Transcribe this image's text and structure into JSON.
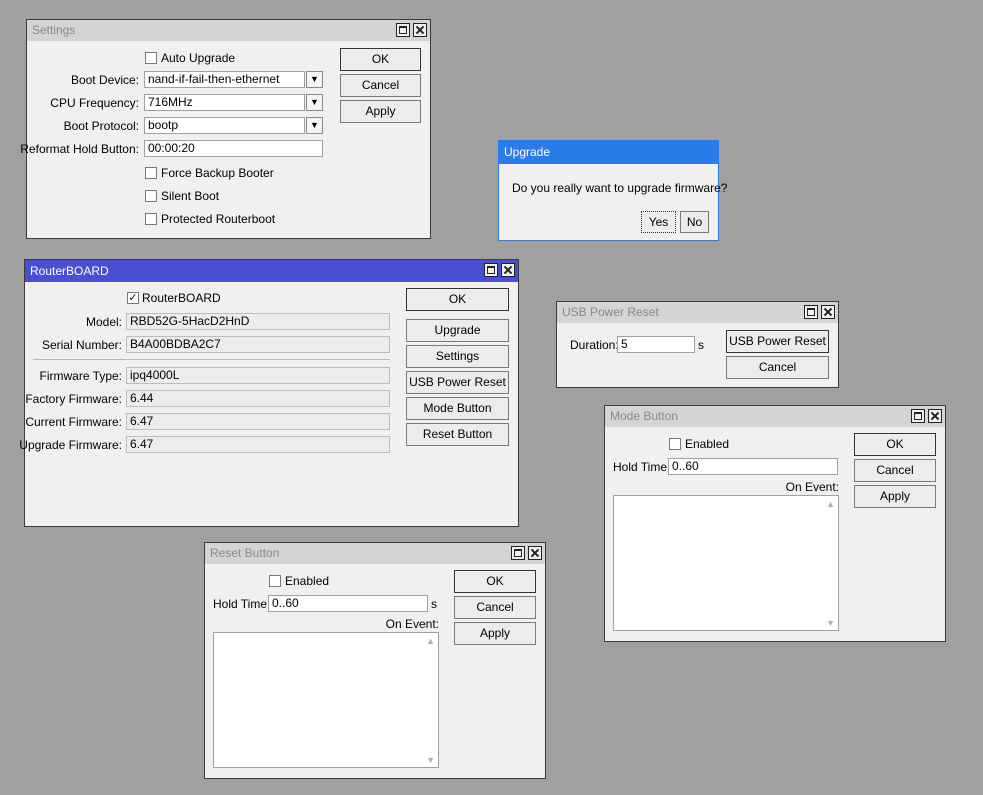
{
  "settings": {
    "title": "Settings",
    "auto_upgrade": {
      "label": "Auto Upgrade",
      "checked": false
    },
    "boot_device": {
      "label": "Boot Device:",
      "value": "nand-if-fail-then-ethernet"
    },
    "cpu_frequency": {
      "label": "CPU Frequency:",
      "value": "716MHz"
    },
    "boot_protocol": {
      "label": "Boot Protocol:",
      "value": "bootp"
    },
    "reformat_hold": {
      "label": "Reformat Hold Button:",
      "value": "00:00:20"
    },
    "force_backup": {
      "label": "Force Backup Booter",
      "checked": false
    },
    "silent_boot": {
      "label": "Silent Boot",
      "checked": false
    },
    "protected_routerboot": {
      "label": "Protected Routerboot",
      "checked": false
    },
    "buttons": {
      "ok": "OK",
      "cancel": "Cancel",
      "apply": "Apply"
    }
  },
  "upgrade": {
    "title": "Upgrade",
    "message": "Do you really want to upgrade firmware?",
    "yes": "Yes",
    "no": "No"
  },
  "routerboard": {
    "title": "RouterBOARD",
    "routerboard_check": {
      "label": "RouterBOARD",
      "checked": true
    },
    "model": {
      "label": "Model:",
      "value": "RBD52G-5HacD2HnD"
    },
    "serial": {
      "label": "Serial Number:",
      "value": "B4A00BDBA2C7"
    },
    "firmware_type": {
      "label": "Firmware Type:",
      "value": "ipq4000L"
    },
    "factory_firmware": {
      "label": "Factory Firmware:",
      "value": "6.44"
    },
    "current_firmware": {
      "label": "Current Firmware:",
      "value": "6.47"
    },
    "upgrade_firmware": {
      "label": "Upgrade Firmware:",
      "value": "6.47"
    },
    "buttons": {
      "ok": "OK",
      "upgrade": "Upgrade",
      "settings": "Settings",
      "usb_power_reset": "USB Power Reset",
      "mode_button": "Mode Button",
      "reset_button": "Reset Button"
    }
  },
  "usb_power_reset": {
    "title": "USB Power Reset",
    "duration": {
      "label": "Duration:",
      "value": "5",
      "unit": "s"
    },
    "buttons": {
      "usb_power_reset": "USB Power Reset",
      "cancel": "Cancel"
    }
  },
  "mode_button": {
    "title": "Mode Button",
    "enabled": {
      "label": "Enabled",
      "checked": false
    },
    "hold_time": {
      "label": "Hold Time:",
      "value": "0..60"
    },
    "on_event": {
      "label": "On Event:"
    },
    "buttons": {
      "ok": "OK",
      "cancel": "Cancel",
      "apply": "Apply"
    }
  },
  "reset_button": {
    "title": "Reset Button",
    "enabled": {
      "label": "Enabled",
      "checked": false
    },
    "hold_time": {
      "label": "Hold Time:",
      "value": "0..60",
      "unit": "s"
    },
    "on_event": {
      "label": "On Event:"
    },
    "buttons": {
      "ok": "OK",
      "cancel": "Cancel",
      "apply": "Apply"
    }
  },
  "icons": {
    "dropdown": "▼",
    "checkmark": "✓",
    "scroll_up": "▲",
    "scroll_down": "▼"
  }
}
